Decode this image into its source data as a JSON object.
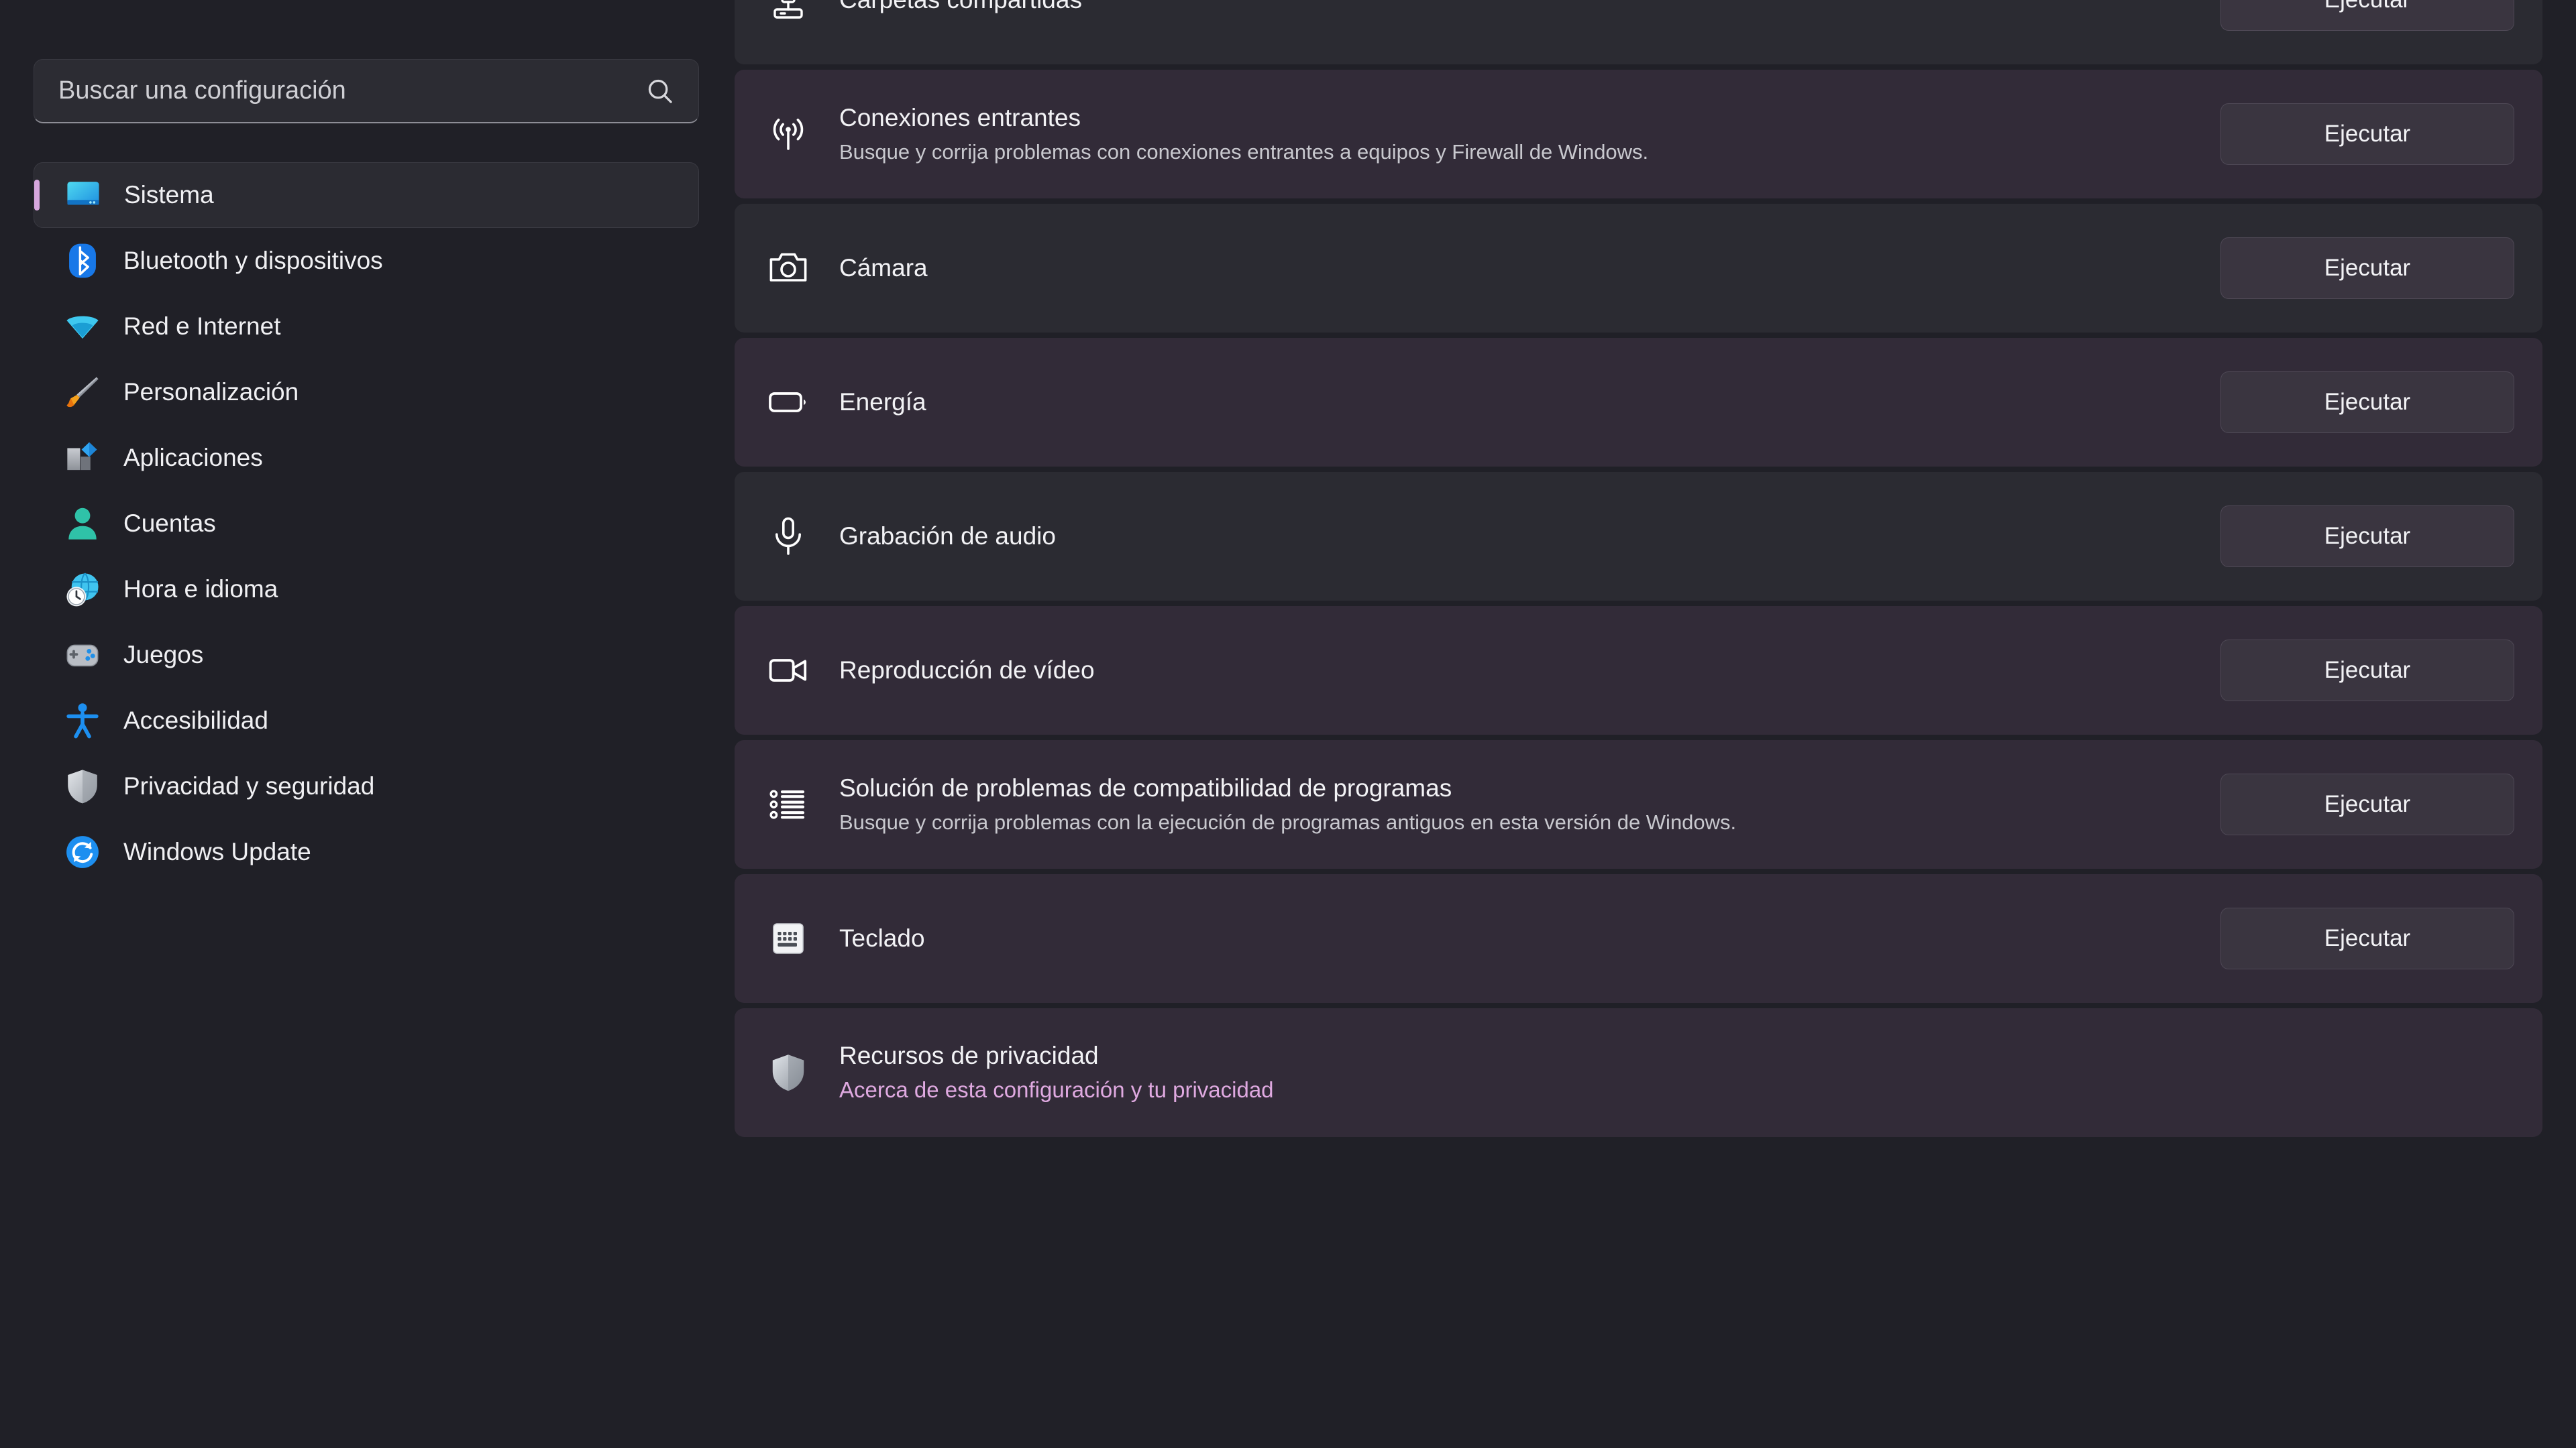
{
  "top_fragment": "■▪▫",
  "search": {
    "placeholder": "Buscar una configuración",
    "value": "",
    "icon": "search-icon"
  },
  "sidebar": {
    "items": [
      {
        "label": "Sistema",
        "icon": "monitor-icon",
        "selected": true
      },
      {
        "label": "Bluetooth y dispositivos",
        "icon": "bluetooth-icon",
        "selected": false
      },
      {
        "label": "Red e Internet",
        "icon": "wifi-icon",
        "selected": false
      },
      {
        "label": "Personalización",
        "icon": "paintbrush-icon",
        "selected": false
      },
      {
        "label": "Aplicaciones",
        "icon": "apps-icon",
        "selected": false
      },
      {
        "label": "Cuentas",
        "icon": "person-icon",
        "selected": false
      },
      {
        "label": "Hora e idioma",
        "icon": "clock-globe-icon",
        "selected": false
      },
      {
        "label": "Juegos",
        "icon": "gamepad-icon",
        "selected": false
      },
      {
        "label": "Accesibilidad",
        "icon": "accessibility-icon",
        "selected": false
      },
      {
        "label": "Privacidad y seguridad",
        "icon": "shield-icon",
        "selected": false
      },
      {
        "label": "Windows Update",
        "icon": "update-icon",
        "selected": false
      }
    ]
  },
  "accent_colors": {
    "selection_bar": "#d6a6dd",
    "link": "#dfa9e0",
    "card_background": "#2b2b32",
    "card_background_tinted": "#322b38",
    "page_background": "#202027"
  },
  "main": {
    "rows": [
      {
        "title": "Carpetas compartidas",
        "desc": "",
        "icon": "server-share-icon",
        "button": "Ejecutar",
        "tinted": false,
        "link": ""
      },
      {
        "title": "Conexiones entrantes",
        "desc": "Busque y corrija problemas con conexiones entrantes a equipos y Firewall de Windows.",
        "icon": "broadcast-icon",
        "button": "Ejecutar",
        "tinted": true,
        "link": ""
      },
      {
        "title": "Cámara",
        "desc": "",
        "icon": "camera-icon",
        "button": "Ejecutar",
        "tinted": false,
        "link": ""
      },
      {
        "title": "Energía",
        "desc": "",
        "icon": "battery-icon",
        "button": "Ejecutar",
        "tinted": true,
        "link": ""
      },
      {
        "title": "Grabación de audio",
        "desc": "",
        "icon": "microphone-icon",
        "button": "Ejecutar",
        "tinted": false,
        "link": ""
      },
      {
        "title": "Reproducción de vídeo",
        "desc": "",
        "icon": "video-icon",
        "button": "Ejecutar",
        "tinted": true,
        "link": ""
      },
      {
        "title": "Solución de problemas de compatibilidad de programas",
        "desc": "Busque y corrija problemas con la ejecución de programas antiguos en esta versión de Windows.",
        "icon": "list-icon",
        "button": "Ejecutar",
        "tinted": true,
        "link": ""
      },
      {
        "title": "Teclado",
        "desc": "",
        "icon": "keyboard-icon",
        "button": "Ejecutar",
        "tinted": true,
        "link": ""
      },
      {
        "title": "Recursos de privacidad",
        "desc": "",
        "icon": "privacy-shield-icon",
        "button": "",
        "tinted": true,
        "link": "Acerca de esta configuración y tu privacidad"
      }
    ]
  }
}
